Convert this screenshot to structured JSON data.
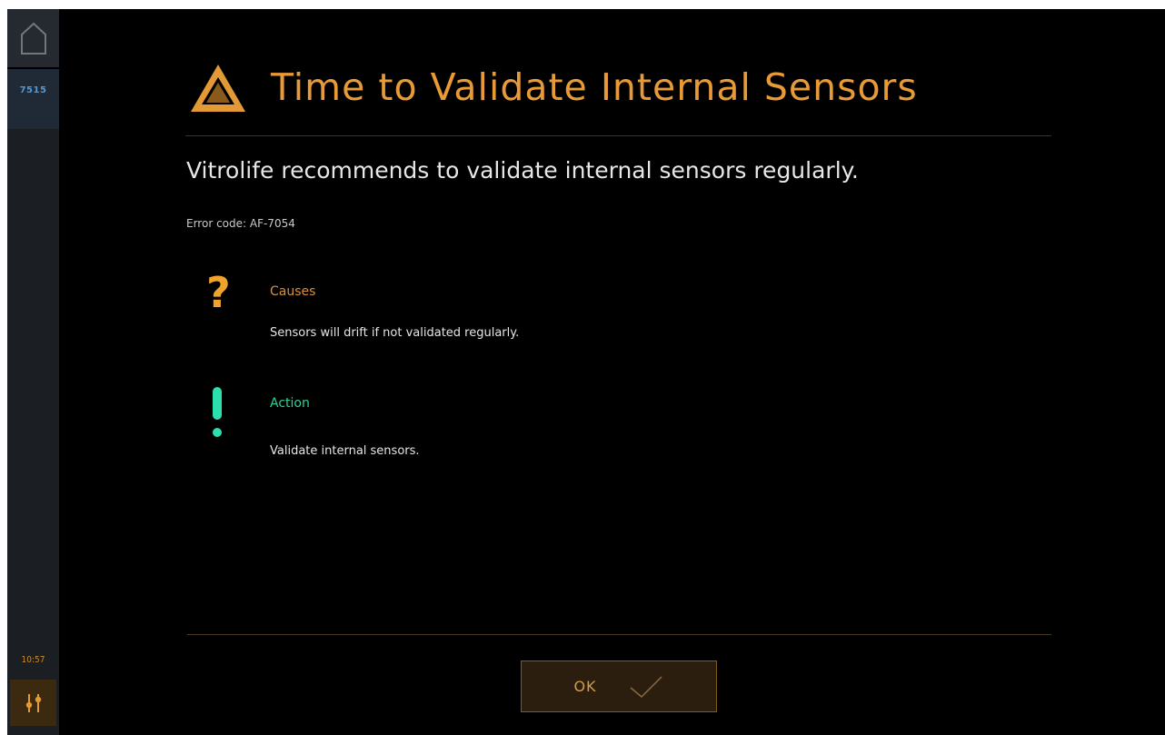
{
  "sidebar": {
    "home_icon": "home-icon",
    "instrument_id": "7515",
    "time": "10:57",
    "settings_icon": "sliders-icon"
  },
  "dialog": {
    "title_icon": "warning-triangle-icon",
    "title": "Time to Validate Internal Sensors",
    "subtitle": "Vitrolife recommends to validate internal sensors regularly.",
    "error_code": "Error code: AF-7054",
    "causes": {
      "icon": "question-mark-icon",
      "title": "Causes",
      "text": "Sensors will drift if not validated regularly."
    },
    "action": {
      "icon": "exclamation-mark-icon",
      "title": "Action",
      "text": "Validate internal sensors."
    },
    "ok_button": {
      "label": "OK",
      "icon": "checkmark-icon"
    }
  },
  "colors": {
    "accent_orange": "#e89a37",
    "action_green": "#2bd19a",
    "instrument_blue": "#4f9ad6",
    "background": "#000000"
  }
}
